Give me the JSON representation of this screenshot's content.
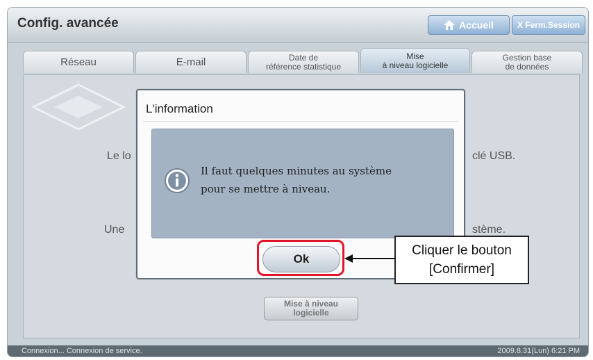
{
  "header": {
    "title": "Config. avancée",
    "home_label": "Accueil",
    "logout_label": "X Ferm.Session"
  },
  "tabs": [
    {
      "line1": "Réseau",
      "line2": ""
    },
    {
      "line1": "E-mail",
      "line2": ""
    },
    {
      "line1": "Date de",
      "line2": "référence statistique"
    },
    {
      "line1": "Mise",
      "line2": "à niveau logicielle"
    },
    {
      "line1": "Gestion base",
      "line2": "de données"
    }
  ],
  "content": {
    "line1_left": "Le lo",
    "line1_right": "clé USB.",
    "line2_left": "Une",
    "line2_right": "stème.",
    "update_button_line1": "Mise à niveau",
    "update_button_line2": "logicielle"
  },
  "dialog": {
    "title": "L'information",
    "message_line1": "Il faut quelques minutes au système",
    "message_line2": "pour se mettre à niveau.",
    "ok_label": "Ok"
  },
  "annotation": {
    "line1": "Cliquer le bouton",
    "line2": "[Confirmer]"
  },
  "status": {
    "left": "Connexion... Connexion de service.",
    "right": "2009.8.31(Lun) 6:21 PM"
  },
  "colors": {
    "accent_blue": "#8fb2d6",
    "highlight_red": "#e0152a",
    "dialog_panel": "#a3b3c4"
  }
}
